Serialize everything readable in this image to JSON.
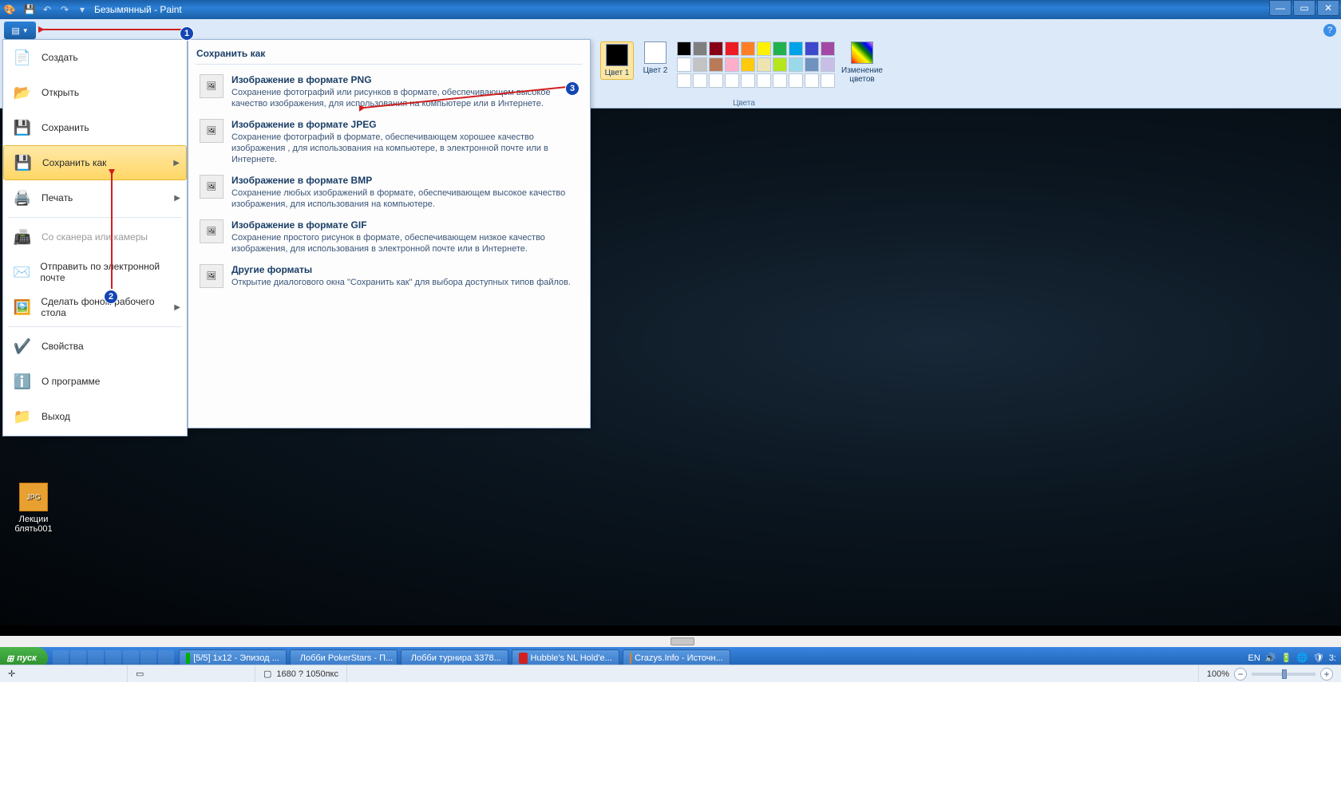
{
  "title": "Безымянный - Paint",
  "help_tooltip": "?",
  "file_tab": "",
  "colors": {
    "color1_label": "Цвет\n1",
    "color2_label": "Цвет\n2",
    "group_label": "Цвета",
    "edit_label": "Изменение\nцветов",
    "row1": [
      "#000000",
      "#7f7f7f",
      "#880015",
      "#ed1c24",
      "#ff7f27",
      "#fff200",
      "#22b14c",
      "#00a2e8",
      "#3f48cc",
      "#a349a4"
    ],
    "row2": [
      "#ffffff",
      "#c3c3c3",
      "#b97a57",
      "#ffaec9",
      "#ffc90e",
      "#efe4b0",
      "#b5e61d",
      "#99d9ea",
      "#7092be",
      "#c8bfe7"
    ],
    "row3": [
      "#ffffff",
      "#ffffff",
      "#ffffff",
      "#ffffff",
      "#ffffff",
      "#ffffff",
      "#ffffff",
      "#ffffff",
      "#ffffff",
      "#ffffff"
    ]
  },
  "file_menu": [
    {
      "icon": "📄",
      "label": "Создать"
    },
    {
      "icon": "📂",
      "label": "Открыть"
    },
    {
      "icon": "💾",
      "label": "Сохранить"
    },
    {
      "icon": "💾",
      "label": "Сохранить как",
      "sel": true,
      "arrow": true
    },
    {
      "icon": "🖨️",
      "label": "Печать",
      "arrow": true
    },
    {
      "icon": "📠",
      "label": "Со сканера или камеры",
      "disabled": true
    },
    {
      "icon": "✉️",
      "label": "Отправить по электронной почте"
    },
    {
      "icon": "🖼️",
      "label": "Сделать фоном рабочего стола",
      "arrow": true
    },
    {
      "icon": "✔️",
      "label": "Свойства"
    },
    {
      "icon": "ℹ️",
      "label": "О программе"
    },
    {
      "icon": "📁",
      "label": "Выход"
    }
  ],
  "submenu": {
    "title": "Сохранить как",
    "items": [
      {
        "t": "Изображение в формате PNG",
        "d": "Сохранение фотографий или рисунков в формате, обеспечивающем высокое качество изображения, для использования на компьютере или в Интернете."
      },
      {
        "t": "Изображение в формате JPEG",
        "d": "Сохранение фотографий в формате, обеспечивающем хорошее качество изображения , для использования на компьютере, в электронной почте или в Интернете."
      },
      {
        "t": "Изображение в формате BMP",
        "d": "Сохранение любых изображений в формате, обеспечивающем высокое качество изображения, для использования на компьютере."
      },
      {
        "t": "Изображение в формате GIF",
        "d": "Сохранение простого рисунок в формате, обеспечивающем низкое качество изображения, для использования в электронной почте или в Интернете."
      },
      {
        "t": "Другие форматы",
        "d": "Открытие диалогового окна \"Сохранить как\" для выбора доступных типов файлов."
      }
    ]
  },
  "callouts": {
    "1": "1",
    "2": "2",
    "3": "3"
  },
  "desktop_file": {
    "name": "Лекции блять001"
  },
  "taskbar": {
    "start": "пуск",
    "buttons": [
      {
        "label": "[5/5] 1x12 - Эпизод ...",
        "color": "#00b000"
      },
      {
        "label": "Лобби PokerStars - П...",
        "color": "#d02020"
      },
      {
        "label": "Лобби турнира 3378...",
        "color": "#d02020"
      },
      {
        "label": "Hubble's NL Hold'e... ",
        "color": "#d02020"
      },
      {
        "label": "Crazys.Info - Источн...",
        "color": "#e08020"
      }
    ],
    "lang": "EN",
    "time": "3:"
  },
  "status": {
    "size": "1680 ? 1050пкс",
    "zoom": "100%"
  }
}
